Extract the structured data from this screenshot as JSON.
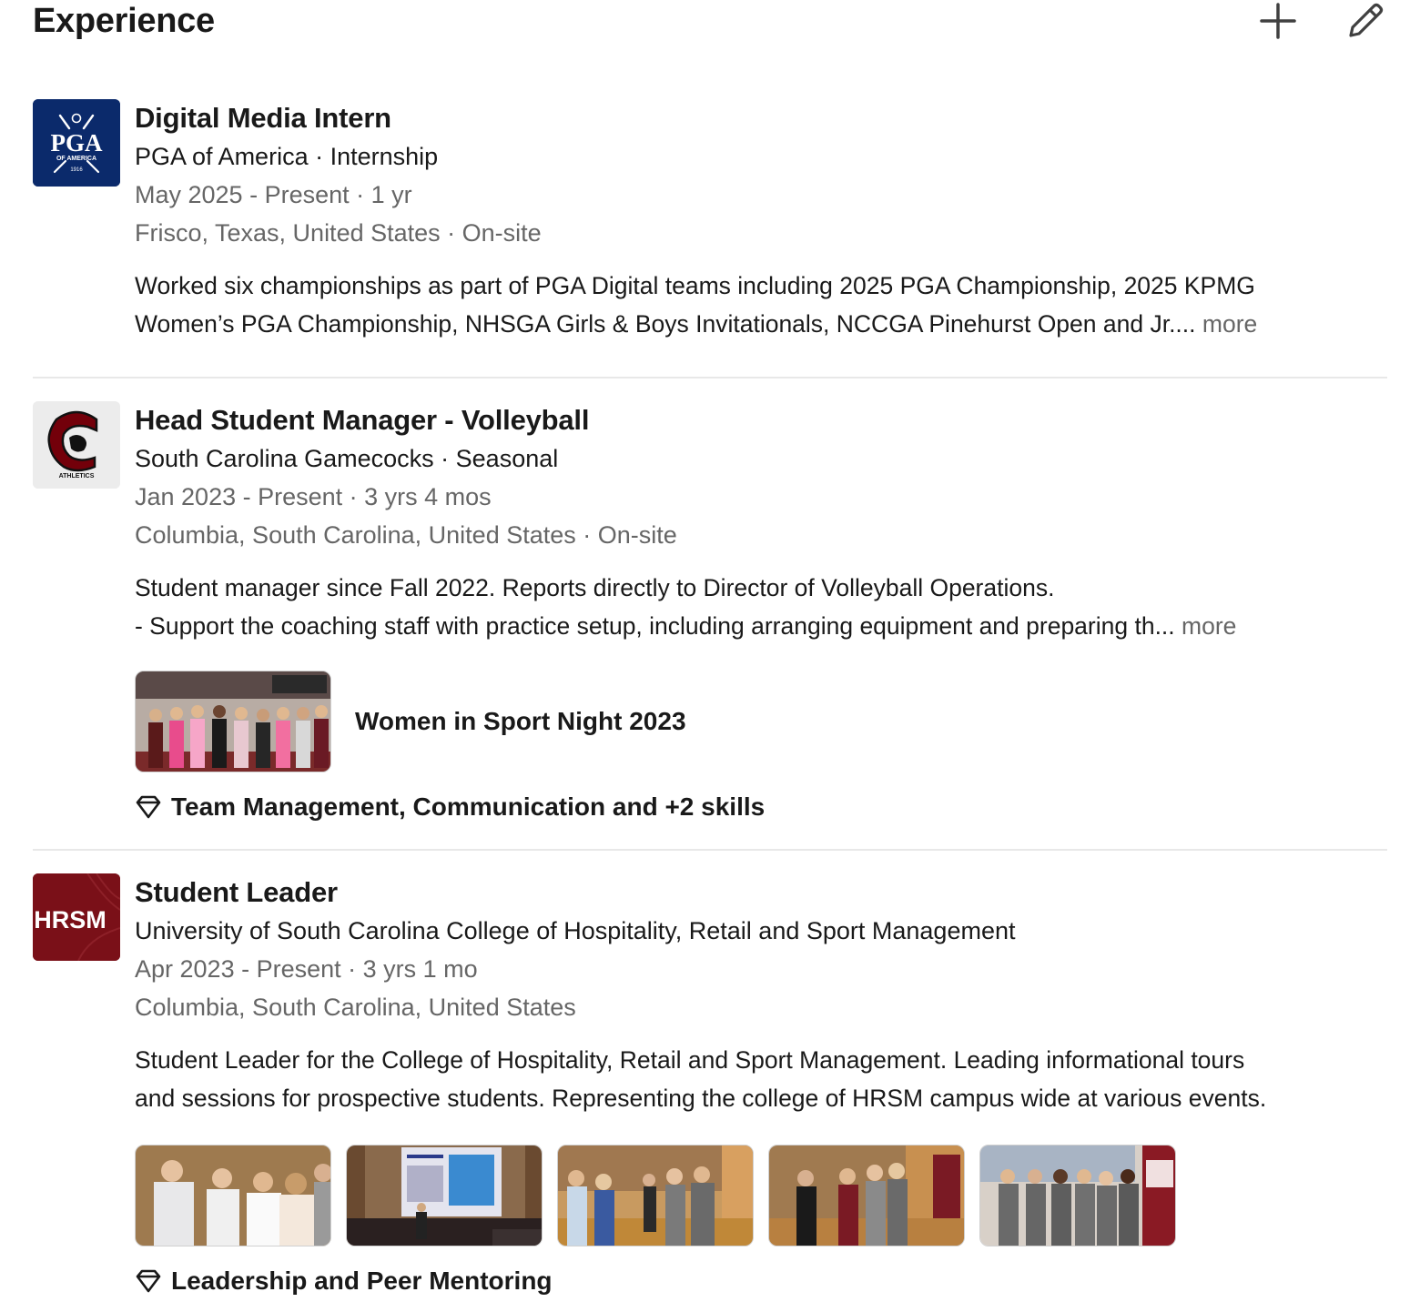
{
  "section": {
    "title": "Experience",
    "add_icon": "plus-icon",
    "edit_icon": "pencil-icon"
  },
  "experiences": [
    {
      "title": "Digital Media Intern",
      "company_line": "PGA of America · Internship",
      "dates": "May 2025 - Present · 1 yr",
      "location": "Frisco, Texas, United States · On-site",
      "description_lines": [
        "Worked six championships as part of PGA Digital teams including 2025 PGA Championship, 2025 KPMG",
        "Women’s PGA Championship, NHSGA Girls & Boys Invitationals, NCCGA Pinehurst Open and Jr.... "
      ],
      "more": "more",
      "logo": {
        "text": "PGA",
        "subtext": "OF AMERICA",
        "year": "1916",
        "color": "#0b2a6b"
      }
    },
    {
      "title": "Head Student Manager - Volleyball",
      "company_line": "South Carolina Gamecocks · Seasonal",
      "dates": "Jan 2023 - Present · 3 yrs 4 mos",
      "location": "Columbia, South Carolina, United States · On-site",
      "description_lines": [
        "Student manager since Fall 2022. Reports directly to Director of Volleyball Operations.",
        "- Support the coaching staff with practice setup, including arranging equipment and preparing th... "
      ],
      "more": "more",
      "media_title": "Women in Sport Night 2023",
      "skills": "Team Management, Communication and +2 skills",
      "logo": {
        "text": "ATHLETICS",
        "color": "#73000a"
      }
    },
    {
      "title": "Student Leader",
      "company_line": "University of South Carolina College of Hospitality, Retail and Sport Management",
      "dates": "Apr 2023 - Present · 3 yrs 1 mo",
      "location": "Columbia, South Carolina, United States",
      "description_lines": [
        "Student Leader for the College of Hospitality, Retail and Sport Management. Leading informational tours",
        "and sessions for prospective students. Representing the college of HRSM campus wide at various events."
      ],
      "skills": "Leadership and Peer Mentoring",
      "logo": {
        "text": "HRSM",
        "color": "#7a1018"
      }
    }
  ]
}
